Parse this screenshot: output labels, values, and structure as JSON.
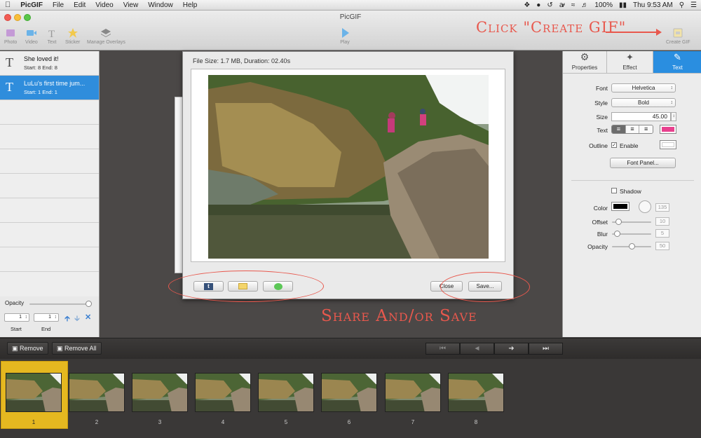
{
  "menubar": {
    "apple": "",
    "app": "PicGIF",
    "menus": [
      "File",
      "Edit",
      "Video",
      "View",
      "Window",
      "Help"
    ],
    "battery": "100%",
    "clock": "Thu 9:53 AM"
  },
  "window": {
    "title": "PicGIF"
  },
  "toolbar": {
    "items": [
      {
        "label": "Photo",
        "icon": "photo-icon"
      },
      {
        "label": "Video",
        "icon": "video-icon"
      },
      {
        "label": "Text",
        "icon": "text-icon"
      },
      {
        "label": "Sticker",
        "icon": "sticker-icon"
      },
      {
        "label": "Manage Overlays",
        "icon": "layers-icon"
      }
    ],
    "play": "Play",
    "create": "Create GIF"
  },
  "annotations": {
    "create": "Click \"Create GIF\"",
    "share": "Share And/or Save"
  },
  "layers": [
    {
      "name": "She loved it!",
      "range": "Start: 8 End: 8",
      "icon": "T"
    },
    {
      "name": "LuLu's first time jum...",
      "range": "Start: 1 End: 1",
      "icon": "T"
    }
  ],
  "left_bottom": {
    "opacity_label": "Opacity",
    "opacity_value": 1.0,
    "start_value": "1",
    "end_value": "1",
    "start_label": "Start",
    "end_label": "End"
  },
  "preview": {
    "file_info": "File Size: 1.7 MB,  Duration: 02.40s",
    "close": "Close",
    "save": "Save...",
    "share_icons": [
      "tumblr-icon",
      "mail-icon",
      "message-icon"
    ]
  },
  "right_panel": {
    "tabs": [
      {
        "label": "Properties",
        "icon": "gear-icon"
      },
      {
        "label": "Effect",
        "icon": "wand-icon"
      },
      {
        "label": "Text",
        "icon": "edit-icon"
      }
    ],
    "font_label": "Font",
    "font": "Helvetica",
    "style_label": "Style",
    "style": "Bold",
    "size_label": "Size",
    "size": "45.00",
    "text_label": "Text",
    "text_color": "#e8408e",
    "outline_label": "Outline",
    "outline_enable": "Enable",
    "font_panel": "Font Panel...",
    "shadow_label": "Shadow",
    "color_label": "Color",
    "color_value": "135",
    "offset_label": "Offset",
    "offset_value": "10",
    "blur_label": "Blur",
    "blur_value": "5",
    "opacity_label": "Opacity",
    "opacity_value": "50"
  },
  "bottombar": {
    "remove": "Remove",
    "remove_all": "Remove All"
  },
  "frames": [
    {
      "label": "1",
      "selected": true
    },
    {
      "label": "2"
    },
    {
      "label": "3"
    },
    {
      "label": "4"
    },
    {
      "label": "5"
    },
    {
      "label": "6"
    },
    {
      "label": "7"
    },
    {
      "label": "8"
    }
  ],
  "colors": {
    "accent": "#2a8ee0",
    "annotation": "#e8584d",
    "selected_frame": "#e5b820"
  }
}
